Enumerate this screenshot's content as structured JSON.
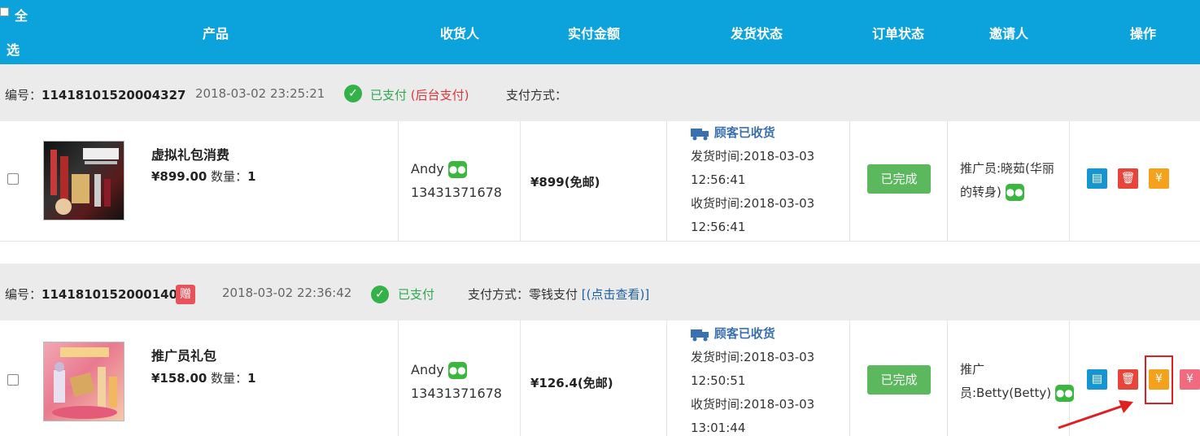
{
  "header": {
    "select_all_1": "全",
    "select_all_2": "选",
    "product": "产品",
    "receiver": "收货人",
    "paid_amount": "实付金额",
    "shipping_status": "发货状态",
    "order_status": "订单状态",
    "inviter": "邀请人",
    "actions": "操作"
  },
  "orders": [
    {
      "number_label": "编号：",
      "number": "11418101520004327",
      "time": "2018-03-02 23:25:21",
      "paid": "已支付",
      "paid_extra": "(后台支付)",
      "pay_method": "支付方式：",
      "product_name": "虚拟礼包消费",
      "price": "¥899.00",
      "qty_label": "数量：",
      "qty": "1",
      "receiver_name": "Andy",
      "receiver_phone": "13431371678",
      "amount": "¥899(免邮)",
      "ship_status": "顾客已收货",
      "ship_time_1": "发货时间:2018-03-03",
      "ship_time_2": "12:56:41",
      "recv_time_1": "收货时间:2018-03-03",
      "recv_time_2": "12:56:41",
      "order_status": "已完成",
      "inviter_1": "推广员:晓茹(华丽",
      "inviter_2": "的转身)"
    },
    {
      "number_label": "编号：",
      "number": "11418101520001408",
      "gift": "赠",
      "time": "2018-03-02 22:36:42",
      "paid": "已支付",
      "pay_method": "支付方式：零钱支付",
      "pay_link": "[(点击查看)]",
      "product_name": "推广员礼包",
      "price": "¥158.00",
      "qty_label": "数量：",
      "qty": "1",
      "receiver_name": "Andy",
      "receiver_phone": "13431371678",
      "amount": "¥126.4(免邮)",
      "ship_status": "顾客已收货",
      "ship_time_1": "发货时间:2018-03-03",
      "ship_time_2": "12:50:51",
      "recv_time_1": "收货时间:2018-03-03",
      "recv_time_2": "13:01:44",
      "order_status": "已完成",
      "inviter_1": "推广",
      "inviter_2": "员:Betty(Betty)"
    }
  ],
  "colors": {
    "header_bg": "#0ca3dd",
    "paid_green": "#2fa84f",
    "done_green": "#5cb85c",
    "ship_blue": "#3a6fb0"
  }
}
